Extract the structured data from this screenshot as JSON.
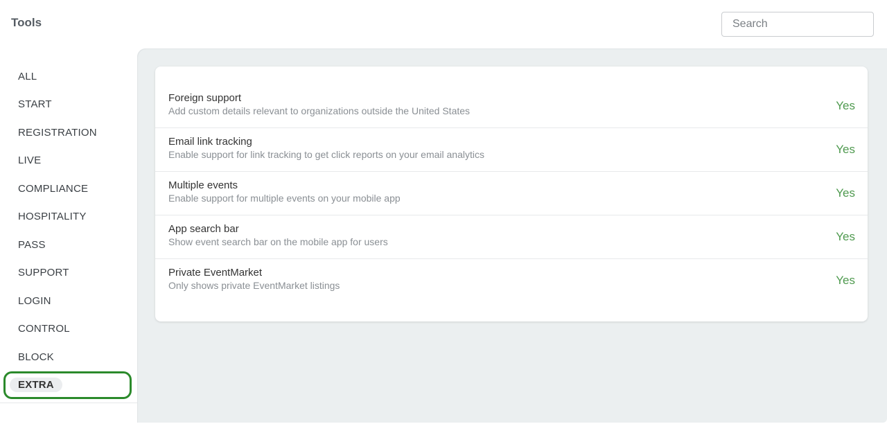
{
  "header": {
    "title": "Tools",
    "search": {
      "placeholder": "Search",
      "value": ""
    }
  },
  "sidebar": {
    "items": [
      {
        "label": "ALL",
        "active": false
      },
      {
        "label": "START",
        "active": false
      },
      {
        "label": "REGISTRATION",
        "active": false
      },
      {
        "label": "LIVE",
        "active": false
      },
      {
        "label": "COMPLIANCE",
        "active": false
      },
      {
        "label": "HOSPITALITY",
        "active": false
      },
      {
        "label": "PASS",
        "active": false
      },
      {
        "label": "SUPPORT",
        "active": false
      },
      {
        "label": "LOGIN",
        "active": false
      },
      {
        "label": "CONTROL",
        "active": false
      },
      {
        "label": "BLOCK",
        "active": false
      },
      {
        "label": "EXTRA",
        "active": true
      }
    ],
    "highlight_color": "#2b8a2b"
  },
  "settings": [
    {
      "title": "Foreign support",
      "description": "Add custom details relevant to organizations outside the United States",
      "value": "Yes"
    },
    {
      "title": "Email link tracking",
      "description": "Enable support for link tracking to get click reports on your email analytics",
      "value": "Yes"
    },
    {
      "title": "Multiple events",
      "description": "Enable support for multiple events on your mobile app",
      "value": "Yes"
    },
    {
      "title": "App search bar",
      "description": "Show event search bar on the mobile app for users",
      "value": "Yes"
    },
    {
      "title": "Private EventMarket",
      "description": "Only shows private EventMarket listings",
      "value": "Yes"
    }
  ],
  "colors": {
    "value_yes": "#4f9a4f",
    "background": "#ebeff0"
  }
}
